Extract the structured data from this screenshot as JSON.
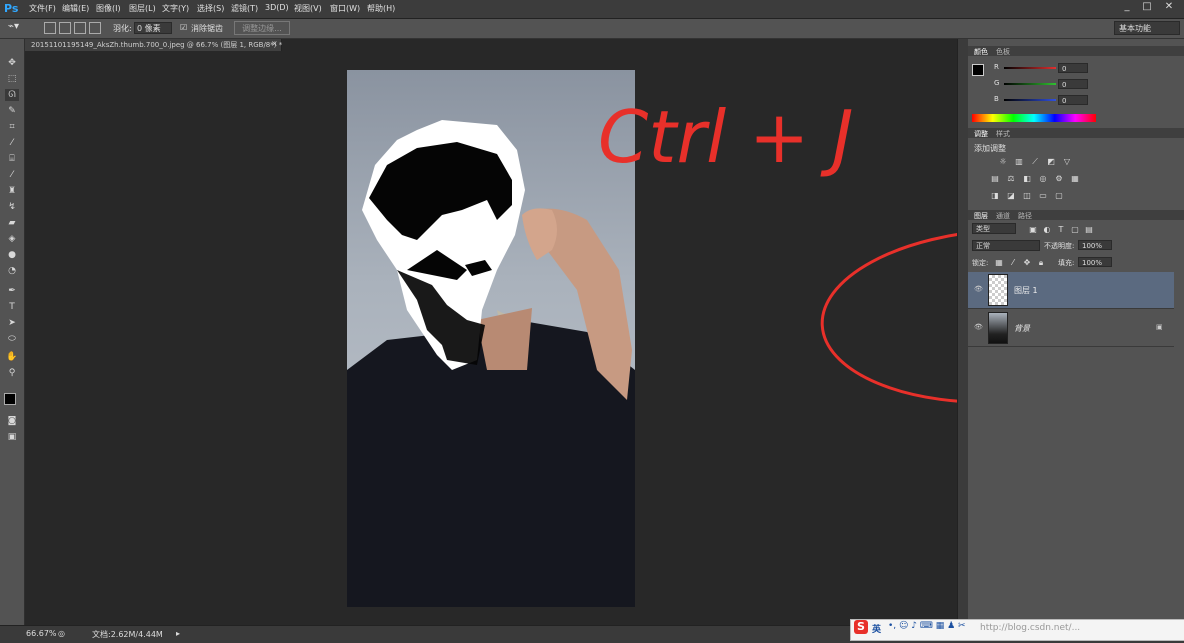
{
  "menubar": {
    "logo": "Ps",
    "items": [
      "文件(F)",
      "编辑(E)",
      "图像(I)",
      "图层(L)",
      "文字(Y)",
      "选择(S)",
      "滤镜(T)",
      "3D(D)",
      "视图(V)",
      "窗口(W)",
      "帮助(H)"
    ],
    "window_controls": [
      "_",
      "□",
      "✕"
    ]
  },
  "options": {
    "feather_label": "羽化:",
    "feather_value": "0 像素",
    "antialias_label": "消除锯齿",
    "refine_edge": "调整边缘...",
    "workspace": "基本功能"
  },
  "document": {
    "tab_title": "20151101195149_AksZh.thumb.700_0.jpeg @ 66.7% (图层 1, RGB/8*) *",
    "close": "×"
  },
  "tools": [
    "move-tool",
    "marquee-tool",
    "lasso-tool",
    "quick-select-tool",
    "crop-tool",
    "eyedropper-tool",
    "healing-tool",
    "brush-tool",
    "stamp-tool",
    "history-brush-tool",
    "eraser-tool",
    "gradient-tool",
    "blur-tool",
    "dodge-tool",
    "pen-tool",
    "type-tool",
    "path-select-tool",
    "shape-tool",
    "hand-tool",
    "zoom-tool"
  ],
  "color_panel": {
    "tabs": [
      "颜色",
      "色板"
    ],
    "channels": [
      {
        "label": "R",
        "value": "0",
        "color": "#e03030"
      },
      {
        "label": "G",
        "value": "0",
        "color": "#30c030"
      },
      {
        "label": "B",
        "value": "0",
        "color": "#3050e0"
      }
    ]
  },
  "adjust_panel": {
    "tabs": [
      "调整",
      "样式"
    ],
    "title": "添加调整"
  },
  "layers_panel": {
    "tabs": [
      "图层",
      "通道",
      "路径"
    ],
    "filter_kind": "类型",
    "blend_mode": "正常",
    "opacity_label": "不透明度:",
    "opacity_value": "100%",
    "lock_label": "锁定:",
    "fill_label": "填充:",
    "fill_value": "100%",
    "layers": [
      {
        "name": "图层 1",
        "selected": true
      },
      {
        "name": "背景",
        "selected": false,
        "locked": true
      }
    ]
  },
  "status": {
    "zoom": "66.67%",
    "doc_info": "文档:2.62M/4.44M"
  },
  "tray": {
    "ime": "英",
    "watermark": "http://blog.csdn.net/..."
  },
  "annotation": {
    "text": "Ctrl + J",
    "color": "#e8302a"
  }
}
